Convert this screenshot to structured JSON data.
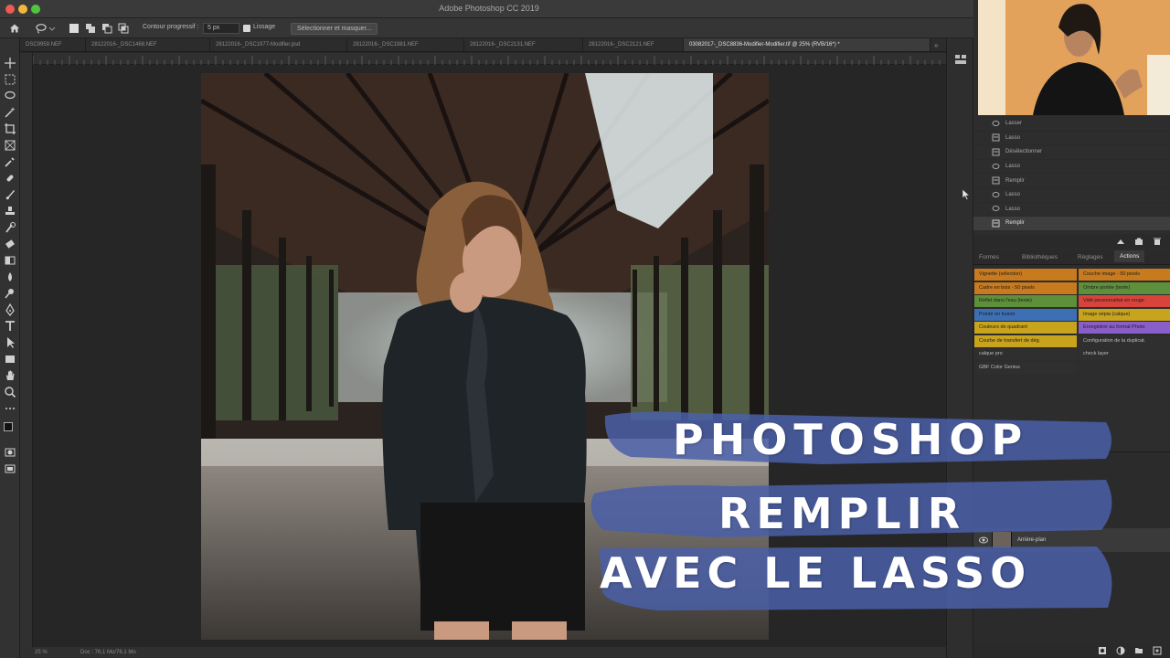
{
  "app": {
    "window_title": "Adobe Photoshop CC 2019"
  },
  "options_bar": {
    "feather_label": "Contour progressif :",
    "feather_value": "5 px",
    "antialias_label": "Lissage",
    "select_mask_button": "Sélectionner et masquer..."
  },
  "tabs": [
    {
      "label": "DSC9959.NEF"
    },
    {
      "label": "28122016-_DSC1468.NEF"
    },
    {
      "label": "28122016-_DSC1977-Modifier.psd"
    },
    {
      "label": "28122016-_DSC1981.NEF"
    },
    {
      "label": "28122016-_DSC2131.NEF"
    },
    {
      "label": "28122016-_DSC2121.NEF"
    },
    {
      "label": "03082017-_DSC8836-Modifier-Modifier.tif @ 25% (RVB/16*) *"
    }
  ],
  "status_bar": {
    "zoom": "25 %",
    "doc_info": "Doc : 76,1 Mo/76,1 Mo"
  },
  "history": {
    "items": [
      {
        "label": "Lasser",
        "active": false
      },
      {
        "label": "Lasso",
        "active": false
      },
      {
        "label": "Désélectionner",
        "active": false
      },
      {
        "label": "Lasso",
        "active": false
      },
      {
        "label": "Remplir",
        "active": false
      },
      {
        "label": "Lasso",
        "active": false
      },
      {
        "label": "Lasso",
        "active": false
      },
      {
        "label": "Remplir",
        "active": true
      }
    ]
  },
  "panel_tabs": {
    "formes": "Formes",
    "bibliotheques": "Bibliothèques",
    "reglages": "Réglages",
    "actions": "Actions"
  },
  "actions": {
    "left": [
      {
        "label": "Vignette (sélection)",
        "color": "#c87a1e"
      },
      {
        "label": "Cadre en bois - 50 pixels",
        "color": "#c87a1e"
      },
      {
        "label": "Reflet dans l'eau (texte)",
        "color": "#5e8f3a"
      },
      {
        "label": "Pointé en fusion",
        "color": "#3d6fb5"
      },
      {
        "label": "Couleurs de quadrant",
        "color": "#c8a31e"
      },
      {
        "label": "Courbe de transfert de dég.",
        "color": "#c8a31e"
      },
      {
        "label": "calque pro",
        "color": "#2f2f2f"
      },
      {
        "label": "GBF Color Genius",
        "color": "#2f2f2f"
      }
    ],
    "right": [
      {
        "label": "Couche image - 50 pixels",
        "color": "#c87a1e"
      },
      {
        "label": "Ombre portée (texte)",
        "color": "#5e8f3a"
      },
      {
        "label": "Vidé personnalisé en rouge",
        "color": "#d8433b"
      },
      {
        "label": "Image sépia (calque)",
        "color": "#c8a31e"
      },
      {
        "label": "Enregistrer au format Photo",
        "color": "#8a5ec8"
      },
      {
        "label": "Configuration de la duplicat.",
        "color": "#2f2f2f"
      },
      {
        "label": "check layer",
        "color": "#2f2f2f"
      }
    ]
  },
  "layers": {
    "background_name": "Arrière-plan"
  },
  "overlay": {
    "line1": "PHOTOSHOP",
    "line2": "REMPLIR",
    "line3": "AVEC LE LASSO",
    "brush_color": "#4a5fa8"
  }
}
